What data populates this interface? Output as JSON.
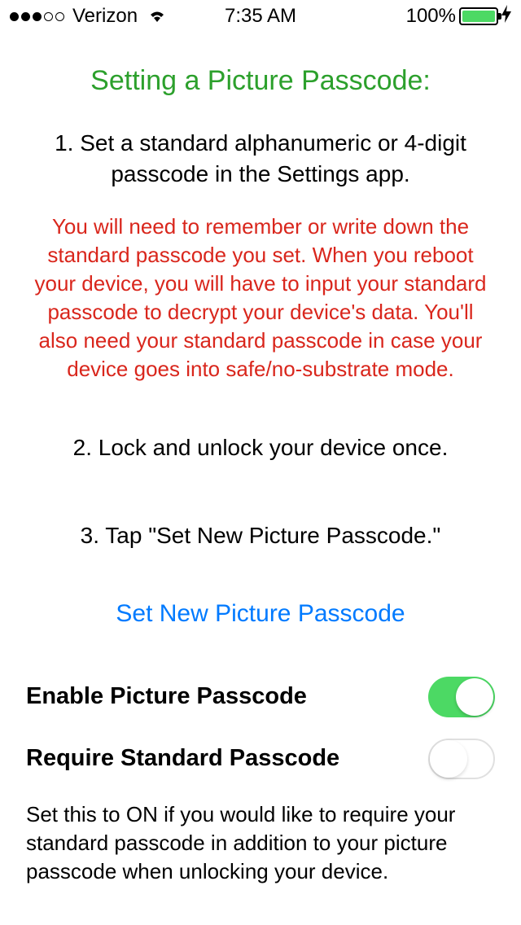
{
  "status_bar": {
    "carrier": "Verizon",
    "time": "7:35 AM",
    "battery_percent": "100%"
  },
  "content": {
    "title": "Setting a Picture Passcode:",
    "step1": "1. Set a standard alphanumeric or 4-digit passcode in the Settings app.",
    "warning": "You will need to remember or write down the standard passcode you set. When you reboot your device, you will have to input your standard passcode to decrypt your device's data. You'll also need your standard passcode in case your device goes into safe/no-substrate mode.",
    "step2": "2. Lock and unlock your device once.",
    "step3": "3. Tap \"Set New Picture Passcode.\"",
    "button_label": "Set New Picture Passcode",
    "settings": {
      "enable_label": "Enable Picture Passcode",
      "enable_value": true,
      "require_label": "Require Standard Passcode",
      "require_value": false,
      "require_description": "Set this to ON if you would like to require your standard passcode in addition to your picture passcode when unlocking your device."
    }
  }
}
